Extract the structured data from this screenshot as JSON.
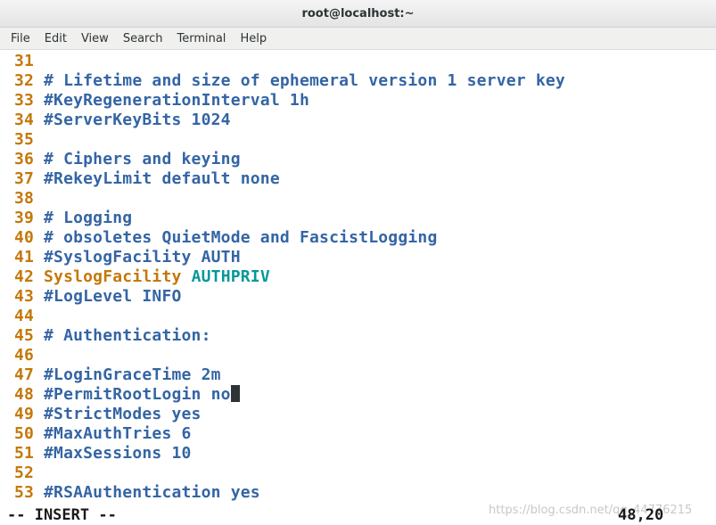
{
  "window": {
    "title": "root@localhost:~"
  },
  "menu": [
    "File",
    "Edit",
    "View",
    "Search",
    "Terminal",
    "Help"
  ],
  "lines": [
    {
      "num": "31",
      "text": ""
    },
    {
      "num": "32",
      "text": "# Lifetime and size of ephemeral version 1 server key"
    },
    {
      "num": "33",
      "text": "#KeyRegenerationInterval 1h"
    },
    {
      "num": "34",
      "text": "#ServerKeyBits 1024"
    },
    {
      "num": "35",
      "text": ""
    },
    {
      "num": "36",
      "text": "# Ciphers and keying"
    },
    {
      "num": "37",
      "text": "#RekeyLimit default none"
    },
    {
      "num": "38",
      "text": ""
    },
    {
      "num": "39",
      "text": "# Logging"
    },
    {
      "num": "40",
      "text": "# obsoletes QuietMode and FascistLogging"
    },
    {
      "num": "41",
      "text": "#SyslogFacility AUTH"
    },
    {
      "num": "42",
      "keyword": "SyslogFacility",
      "value": "AUTHPRIV"
    },
    {
      "num": "43",
      "text": "#LogLevel INFO"
    },
    {
      "num": "44",
      "text": ""
    },
    {
      "num": "45",
      "text": "# Authentication:"
    },
    {
      "num": "46",
      "text": ""
    },
    {
      "num": "47",
      "text": "#LoginGraceTime 2m"
    },
    {
      "num": "48",
      "text": "#PermitRootLogin no",
      "cursor": true
    },
    {
      "num": "49",
      "text": "#StrictModes yes"
    },
    {
      "num": "50",
      "text": "#MaxAuthTries 6"
    },
    {
      "num": "51",
      "text": "#MaxSessions 10"
    },
    {
      "num": "52",
      "text": ""
    },
    {
      "num": "53",
      "text": "#RSAAuthentication yes"
    }
  ],
  "status": {
    "mode": "-- INSERT --",
    "position": "48,20"
  },
  "watermark": "https://blog.csdn.net/qq_44776215",
  "colors": {
    "line_number": "#c4780a",
    "comment": "#3465a4",
    "keyword": "#c4780a",
    "value": "#06989a"
  }
}
